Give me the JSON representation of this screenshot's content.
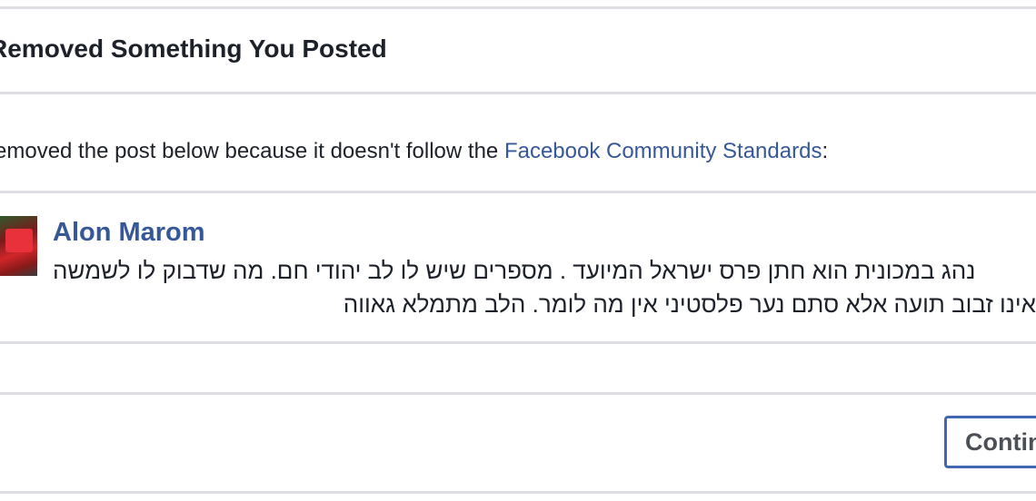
{
  "dialog": {
    "title": "Removed Something You Posted",
    "notice_prefix": "emoved the post below because it doesn't follow the ",
    "notice_link": "Facebook Community Standards",
    "notice_suffix": ":"
  },
  "post": {
    "author": "Alon Marom",
    "line1": "נהג במכונית הוא חתן פרס ישראל המיועד . מספרים שיש לו לב יהודי חם. מה שדבוק לו לשמשה",
    "line2": "אינו זבוב תועה אלא סתם נער פלסטיני אין מה לומר. הלב מתמלא גאווה"
  },
  "actions": {
    "continue_label": "Contin"
  },
  "colors": {
    "link": "#365899",
    "button_border": "#4267b2",
    "divider": "#dddfe2"
  }
}
